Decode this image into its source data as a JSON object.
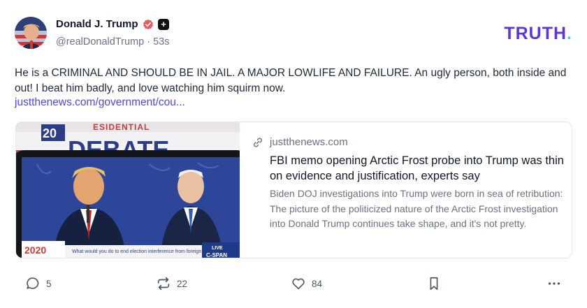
{
  "author": {
    "display_name": "Donald J. Trump",
    "handle": "@realDonaldTrump",
    "time_ago": "53s"
  },
  "brand": {
    "name": "TRUTH",
    "dot": "."
  },
  "post": {
    "text": "He is a CRIMINAL AND SHOULD BE IN JAIL. A MAJOR LOWLIFE AND FAILURE. An ugly person, both inside and out! I beat him badly, and love watching him squirm now.",
    "link_text": "justthenews.com/government/cou..."
  },
  "card": {
    "domain": "justthenews.com",
    "title": "FBI memo opening Arctic Frost probe into Trump was thin on evidence and justification, experts say",
    "description": "Biden DOJ investigations into Trump were born in sea of retribution: The picture of the politicized nature of the Arctic Frost investigation into Donald Trump continues take shape, and it's not pretty.",
    "image": {
      "banner_number": "20",
      "banner_word": "DEBATE",
      "banner_top": "ESIDENTIAL",
      "caption": "What would you do to end election interference from foreign countries",
      "live_label": "LIVE",
      "network": "C-SPAN",
      "logo_text": "2020"
    }
  },
  "actions": {
    "replies": "5",
    "retruths": "22",
    "likes": "84"
  },
  "colors": {
    "brand": "#5d35d8",
    "brand_dot": "#4ad9c0",
    "link": "#4f46e5",
    "verified": "#e8585c"
  }
}
